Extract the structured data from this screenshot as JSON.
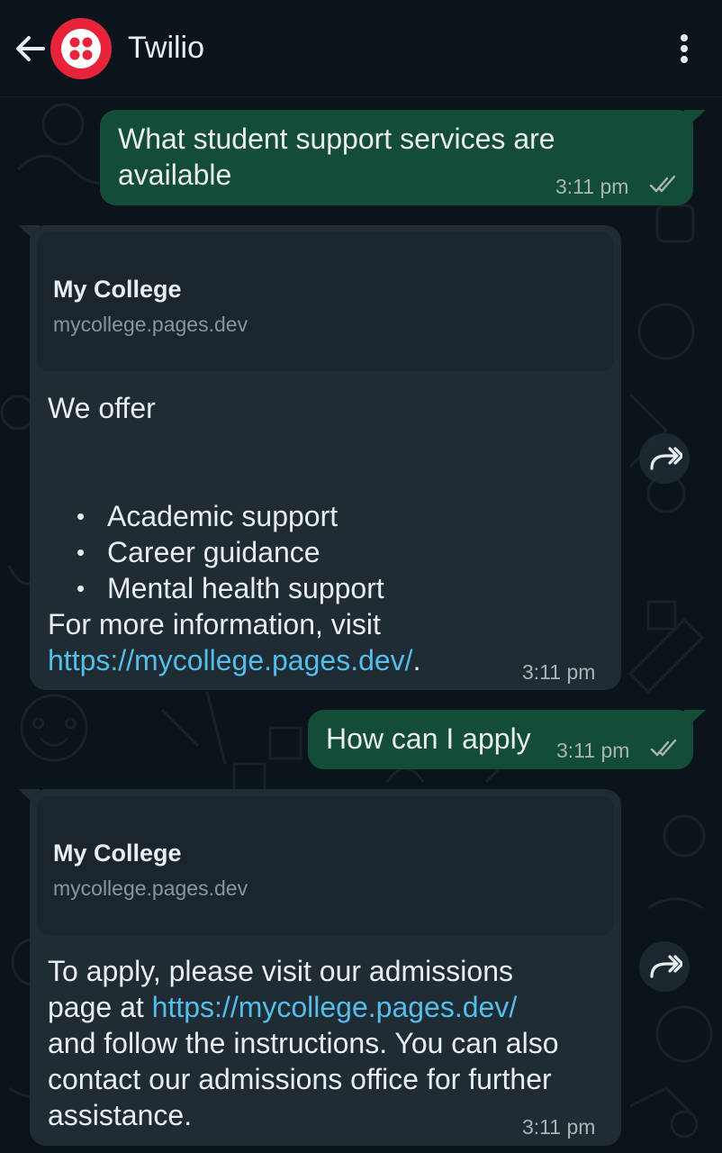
{
  "header": {
    "title": "Twilio",
    "back_icon": "back-arrow-icon",
    "menu_icon": "more-vertical-icon",
    "avatar_color": "#e8243a"
  },
  "messages": [
    {
      "direction": "outgoing",
      "text_line1": "What student support services are",
      "text_line2": "available",
      "time": "3:11 pm",
      "status": "read"
    },
    {
      "direction": "incoming",
      "preview": {
        "title": "My College",
        "url": "mycollege.pages.dev"
      },
      "intro": "We offer",
      "bullets": [
        "Academic support",
        "Career guidance",
        "Mental health support"
      ],
      "outro": "For more information, visit",
      "link": "https://mycollege.pages.dev/",
      "after_link": ".",
      "time": "3:11 pm"
    },
    {
      "direction": "outgoing",
      "text": "How can I apply",
      "time": "3:11 pm",
      "status": "read"
    },
    {
      "direction": "incoming",
      "preview": {
        "title": "My College",
        "url": "mycollege.pages.dev"
      },
      "line1": "To apply, please visit our admissions",
      "line2_prefix": "page at ",
      "link": "https://mycollege.pages.dev/",
      "line3": "and follow the instructions. You can also",
      "line4": "contact our admissions office for further",
      "line5": "assistance.",
      "time": "3:11 pm"
    }
  ],
  "colors": {
    "background": "#0b141a",
    "outgoing_bubble": "#144d37",
    "incoming_bubble": "#1f2c34",
    "link": "#53bdeb"
  }
}
